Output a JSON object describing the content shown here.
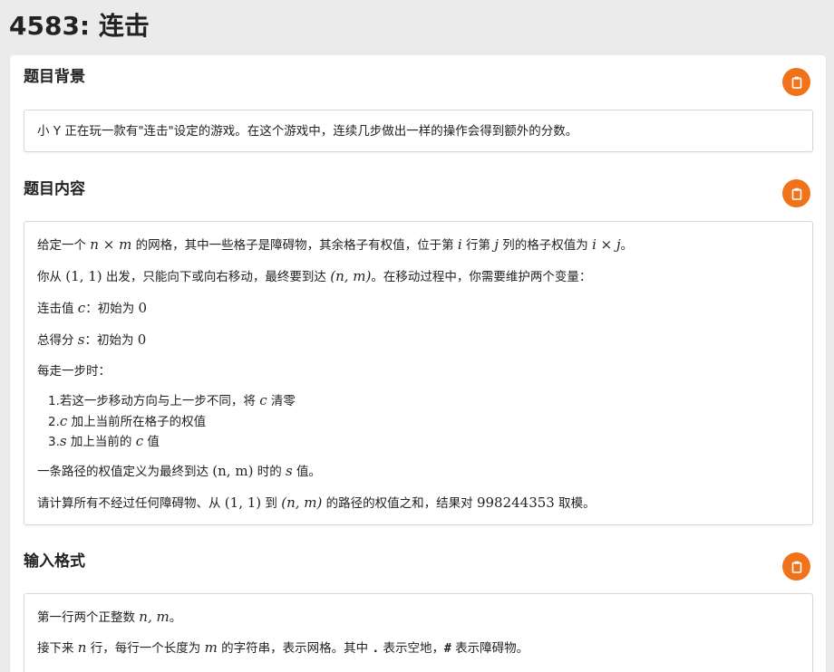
{
  "page": {
    "title": "4583: 连击"
  },
  "sections": {
    "background": {
      "title": "题目背景",
      "text": "小 Y 正在玩一款有\"连击\"设定的游戏。在这个游戏中，连续几步做出一样的操作会得到额外的分数。"
    },
    "content": {
      "title": "题目内容",
      "p1": {
        "a": "给定一个 ",
        "b": "n",
        "c": " × ",
        "d": "m",
        "e": " 的网格，其中一些格子是障碍物，其余格子有权值，位于第 ",
        "f": "i",
        "g": " 行第 ",
        "h": "j",
        "i": " 列的格子权值为 ",
        "j": "i",
        "k": " × ",
        "l": "j",
        "m": "。"
      },
      "p2": {
        "a": "你从 ",
        "b": "(1, 1)",
        "c": " 出发，只能向下或向右移动，最终要到达 ",
        "d": "(n, m)",
        "e": "。在移动过程中，你需要维护两个变量："
      },
      "p3": {
        "a": "连击值 ",
        "b": "c",
        "c": "：初始为 ",
        "d": "0"
      },
      "p4": {
        "a": "总得分 ",
        "b": "s",
        "c": "：初始为 ",
        "d": "0"
      },
      "p5": "每走一步时：",
      "steps": [
        {
          "num": "1.",
          "a": "若这一步移动方向与上一步不同，将 ",
          "b": "c",
          "c": " 清零"
        },
        {
          "num": "2.",
          "a": "",
          "b": "c",
          "c": " 加上当前所在格子的权值"
        },
        {
          "num": "3.",
          "a": "",
          "b": "s",
          "c": " 加上当前的 ",
          "d": "c",
          "e": " 值"
        }
      ],
      "p6": {
        "a": "一条路径的权值定义为最终到达 ",
        "b": "(n, m)",
        "c": " 时的 ",
        "d": "s",
        "e": " 值。"
      },
      "p7": {
        "a": "请计算所有不经过任何障碍物、从 ",
        "b": "(1, 1)",
        "c": " 到 ",
        "d": "(n, m)",
        "e": " 的路径的权值之和，结果对 ",
        "f": "998244353",
        "g": " 取模。"
      }
    },
    "input": {
      "title": "输入格式",
      "p1": {
        "a": "第一行两个正整数 ",
        "b": "n, m",
        "c": "。"
      },
      "p2": {
        "a": "接下来 ",
        "b": "n",
        "c": " 行，每行一个长度为 ",
        "d": "m",
        "e": " 的字符串，表示网格。其中 ",
        "f": ".",
        "g": " 表示空地，",
        "h": "#",
        "i": " 表示障碍物。"
      }
    }
  },
  "icons": {
    "copy": "clipboard-icon"
  },
  "colors": {
    "accent": "#f0731c",
    "background": "#ebebeb"
  }
}
